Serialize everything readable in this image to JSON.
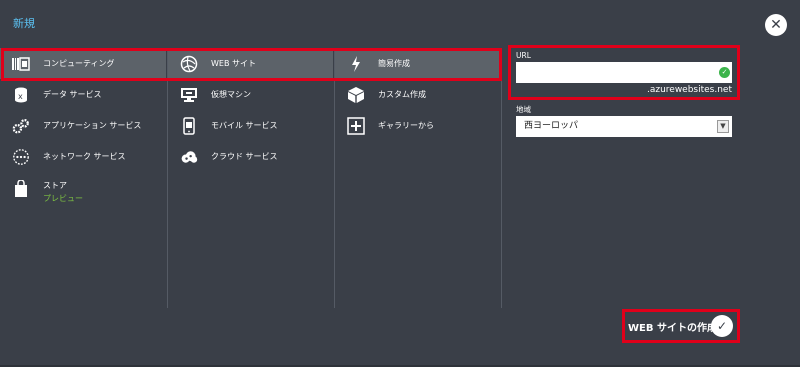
{
  "header": {
    "title": "新規",
    "close_icon": "close-icon"
  },
  "categories": [
    {
      "label": "コンピューティング",
      "icon": "compute-icon",
      "selected": true
    },
    {
      "label": "データ サービス",
      "icon": "data-icon"
    },
    {
      "label": "アプリケーション サービス",
      "icon": "gears-icon"
    },
    {
      "label": "ネットワーク サービス",
      "icon": "network-icon"
    },
    {
      "label": "ストア",
      "sublabel": "プレビュー",
      "icon": "bag-icon"
    }
  ],
  "compute_items": [
    {
      "label": "WEB サイト",
      "icon": "web-icon",
      "selected": true
    },
    {
      "label": "仮想マシン",
      "icon": "vm-icon"
    },
    {
      "label": "モバイル サービス",
      "icon": "mobile-icon"
    },
    {
      "label": "クラウド サービス",
      "icon": "cloud-icon"
    }
  ],
  "options": [
    {
      "label": "簡易作成",
      "icon": "lightning-icon",
      "selected": true
    },
    {
      "label": "カスタム作成",
      "icon": "box-icon"
    },
    {
      "label": "ギャラリーから",
      "icon": "plus-icon"
    }
  ],
  "form": {
    "url_label": "URL",
    "url_value": "",
    "url_suffix": ".azurewebsites.net",
    "region_label": "地域",
    "region_value": "西ヨーロッパ"
  },
  "footer": {
    "create_label": "WEB サイトの作成"
  },
  "colors": {
    "background": "#3a3f48",
    "title": "#5bc0f0",
    "preview": "#7dc242",
    "highlight": "#e0001a",
    "valid": "#3cb44b"
  }
}
